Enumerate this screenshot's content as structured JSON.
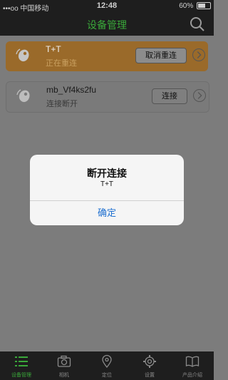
{
  "status_bar": {
    "carrier": "•••oo 中国移动",
    "time": "12:48",
    "battery_text": "60%",
    "battery_level": 0.6
  },
  "nav": {
    "title": "设备管理"
  },
  "devices": [
    {
      "name": "T+T",
      "status": "正在重连",
      "action": "取消重连"
    },
    {
      "name": "mb_Vf4ks2fu",
      "status": "连接断开",
      "action": "连接"
    }
  ],
  "dialog": {
    "title": "断开连接",
    "message": "T+T",
    "ok": "确定"
  },
  "tabs": [
    {
      "label": "设备管理",
      "icon": "list-icon",
      "active": true
    },
    {
      "label": "相机",
      "icon": "camera-icon",
      "active": false
    },
    {
      "label": "定位",
      "icon": "location-pin-icon",
      "active": false
    },
    {
      "label": "设置",
      "icon": "gear-icon",
      "active": false
    },
    {
      "label": "产品介绍",
      "icon": "book-icon",
      "active": false
    }
  ],
  "colors": {
    "accent": "#3aa83a",
    "link": "#1e6fd0",
    "bar": "#1e1e1e",
    "reconnecting_card": "#9a6a2a"
  }
}
